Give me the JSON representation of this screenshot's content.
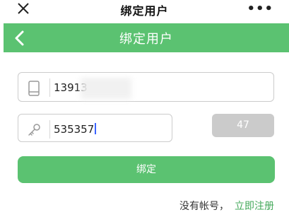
{
  "window": {
    "title": "绑定用户",
    "more_label": "•••"
  },
  "header": {
    "title": "绑定用户"
  },
  "form": {
    "phone_value": "13913",
    "code_value": "535357",
    "countdown_label": "47",
    "bind_button_label": "绑定"
  },
  "footer": {
    "no_account_text": "没有帐号，",
    "register_link": "立即注册"
  },
  "colors": {
    "accent_green": "#5bc271",
    "link_green": "#43a85a",
    "disabled_gray": "#cbcbcb"
  },
  "icons": {
    "close": "close-icon",
    "back": "chevron-left-icon",
    "phone": "phone-icon",
    "key": "key-icon"
  }
}
